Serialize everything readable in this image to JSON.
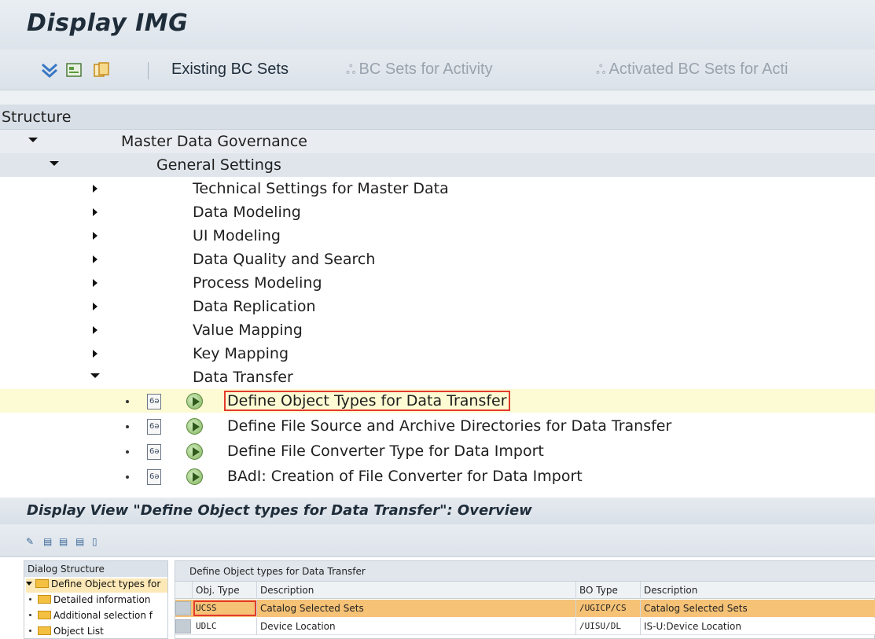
{
  "window": {
    "title": "Display IMG"
  },
  "toolbar": {
    "icons": [
      "expand-all-icon",
      "select-icon",
      "copy-icon"
    ],
    "existing_bc_sets": "Existing BC Sets",
    "bc_sets_for_activity": "BC Sets for Activity",
    "activated_bc_sets": "Activated BC Sets for Acti"
  },
  "structure": {
    "header": "Structure",
    "root": "Master Data Governance",
    "general": "General Settings",
    "children": [
      "Technical Settings for Master Data",
      "Data Modeling",
      "UI Modeling",
      "Data Quality and Search",
      "Process Modeling",
      "Data Replication",
      "Value Mapping",
      "Key Mapping",
      "Data Transfer"
    ],
    "activities": [
      "Define Object Types for Data Transfer",
      "Define File Source and Archive Directories for Data Transfer",
      "Define File Converter Type for Data Import",
      "BAdI: Creation of File Converter for Data Import"
    ]
  },
  "display_view": {
    "title": "Display View \"Define Object types for Data Transfer\": Overview",
    "dialog_structure": {
      "header": "Dialog Structure",
      "items": [
        "Define Object types for",
        "Detailed information",
        "Additional selection f",
        "Object List"
      ]
    },
    "table": {
      "caption": "Define Object types for Data Transfer",
      "columns": [
        "Obj. Type",
        "Description",
        "BO Type",
        "Description"
      ],
      "rows": [
        [
          "UCSS",
          "Catalog Selected Sets",
          "/UGICP/CS",
          "Catalog Selected Sets"
        ],
        [
          "UDLC",
          "Device Location",
          "/UISU/DL",
          "IS-U:Device Location"
        ]
      ]
    }
  },
  "colors": {
    "selected_row": "#fdfbd3",
    "selected_table_row": "#f6c276",
    "focus_outline": "#e23b2e"
  }
}
